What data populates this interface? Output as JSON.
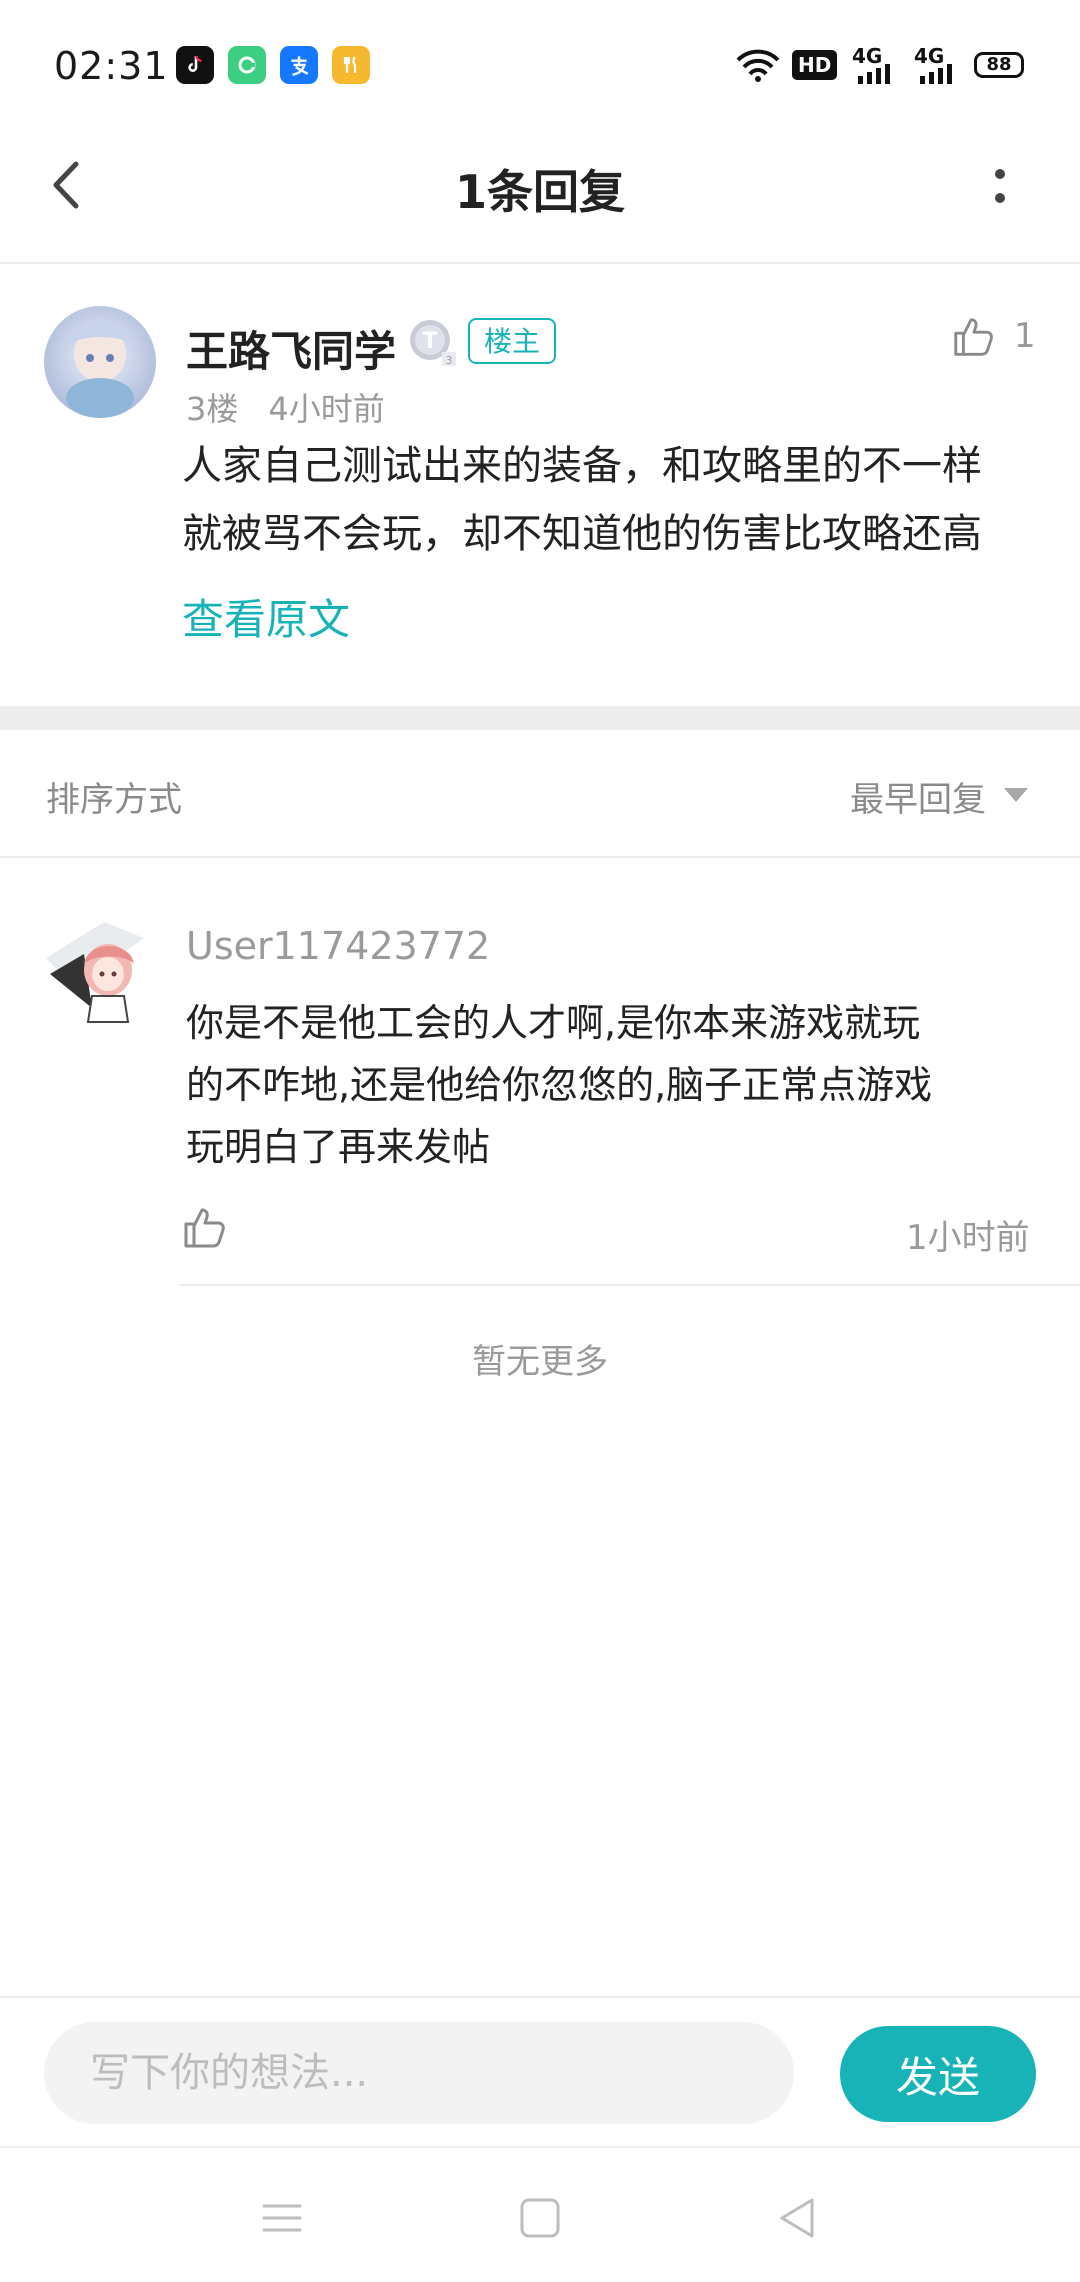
{
  "status_bar": {
    "time": "02:31",
    "hd_label": "HD",
    "network_1": "4G",
    "network_2": "4G",
    "battery": "88"
  },
  "header": {
    "title": "1条回复"
  },
  "post": {
    "author": "王路飞同学",
    "owner_tag": "楼主",
    "floor": "3楼",
    "time": "4小时前",
    "like_count": "1",
    "body_lines": [
      "人家自己测试出来的装备，和攻略里的不一样",
      "就被骂不会玩，却不知道他的伤害比攻略还高"
    ],
    "view_original": "查看原文"
  },
  "sort": {
    "label": "排序方式",
    "selected": "最早回复"
  },
  "replies": [
    {
      "user": "User117423772",
      "body_lines": [
        "你是不是他工会的人才啊,是你本来游戏就玩",
        "的不咋地,还是他给你忽悠的,脑子正常点游戏",
        "玩明白了再来发帖"
      ],
      "time": "1小时前"
    }
  ],
  "no_more": "暂无更多",
  "input": {
    "placeholder": "写下你的想法...",
    "send_label": "发送"
  },
  "colors": {
    "accent": "#17b3b7",
    "muted_text": "#9a9a9a",
    "divider": "#ececec"
  }
}
